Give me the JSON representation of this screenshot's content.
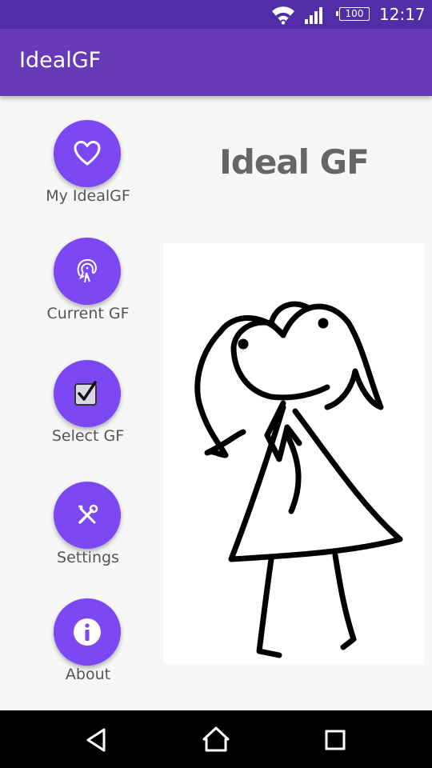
{
  "status_bar": {
    "battery": "100",
    "time": "12:17",
    "icons": [
      "wifi-icon",
      "signal-icon",
      "battery-icon"
    ]
  },
  "app_bar": {
    "title": "IdealGF"
  },
  "menu": {
    "items": [
      {
        "label": "My IdealGF",
        "icon": "heart-icon"
      },
      {
        "label": "Current GF",
        "icon": "girl-face-icon"
      },
      {
        "label": "Select GF",
        "icon": "checkbox-icon"
      },
      {
        "label": "Settings",
        "icon": "tools-icon"
      },
      {
        "label": "About",
        "icon": "info-icon"
      }
    ]
  },
  "main": {
    "heading": "Ideal GF",
    "image": "stick-figure-girl-drawing"
  },
  "nav_bar": {
    "icons": [
      "back-icon",
      "home-icon",
      "recents-icon"
    ]
  },
  "colors": {
    "status_bar": "#512da8",
    "app_bar": "#673ab7",
    "fab": "#7b48f3",
    "background": "#f7f7f7",
    "label_text": "#555555",
    "heading_text": "#666666"
  }
}
